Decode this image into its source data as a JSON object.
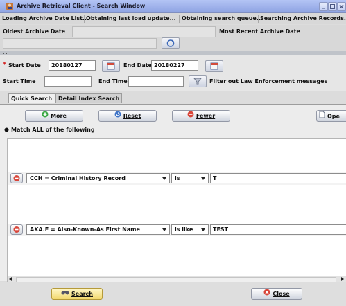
{
  "window": {
    "title": "Archive Retrieval Client - Search Window"
  },
  "status_bar": [
    "Loading Archive Date List...",
    "Obtaining last load update...",
    "Obtaining search queue...",
    "Searching Archive Records..."
  ],
  "archive_dates": {
    "oldest_label": "Oldest Archive Date",
    "most_recent_label": "Most Recent Archive Date"
  },
  "criteria": {
    "required_mark": "*",
    "start_date_label": "Start Date",
    "start_date_value": "20180127",
    "end_date_label": "End Date",
    "end_date_value": "20180227",
    "start_time_label": "Start Time",
    "start_time_value": "",
    "end_time_label": "End Time",
    "end_time_value": "",
    "filter_label": "Filter out Law Enforcement messages"
  },
  "tabs": [
    "Quick Search",
    "Detail Index Search"
  ],
  "buttons": {
    "more": "More",
    "reset": "Reset",
    "fewer": "Fewer",
    "open": "Ope",
    "search": "Search",
    "close": "Close"
  },
  "match_label": "Match ALL of the following",
  "rules": [
    {
      "field": "CCH = Criminal History Record",
      "operator": "is",
      "value": "T"
    },
    {
      "field": "AKA.F = Also-Known-As First Name",
      "operator": "is like",
      "value": "TEST"
    }
  ],
  "colors": {
    "title_bar": "#9db0ec",
    "remove_icon": "#d9463a",
    "more_icon": "#3aa845",
    "reset_icon": "#3f74c8"
  }
}
